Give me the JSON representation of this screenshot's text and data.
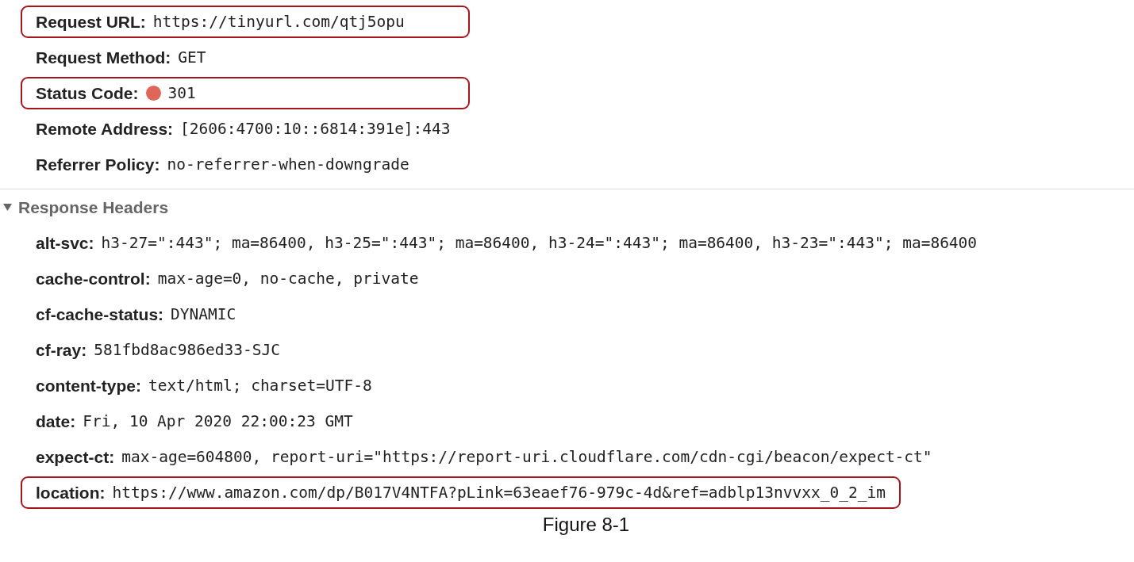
{
  "general": [
    {
      "name": "Request URL:",
      "value": "https://tinyurl.com/qtj5opu",
      "highlighted": true,
      "kind": "text"
    },
    {
      "name": "Request Method:",
      "value": "GET",
      "highlighted": false,
      "kind": "text"
    },
    {
      "name": "Status Code:",
      "value": "301",
      "highlighted": true,
      "kind": "status"
    },
    {
      "name": "Remote Address:",
      "value": "[2606:4700:10::6814:391e]:443",
      "highlighted": false,
      "kind": "text"
    },
    {
      "name": "Referrer Policy:",
      "value": "no-referrer-when-downgrade",
      "highlighted": false,
      "kind": "text"
    }
  ],
  "response_headers": {
    "title": "Response Headers",
    "expanded": true,
    "rows": [
      {
        "name": "alt-svc:",
        "value": "h3-27=\":443\"; ma=86400, h3-25=\":443\"; ma=86400, h3-24=\":443\"; ma=86400, h3-23=\":443\"; ma=86400",
        "highlighted": false
      },
      {
        "name": "cache-control:",
        "value": "max-age=0, no-cache, private",
        "highlighted": false
      },
      {
        "name": "cf-cache-status:",
        "value": "DYNAMIC",
        "highlighted": false
      },
      {
        "name": "cf-ray:",
        "value": "581fbd8ac986ed33-SJC",
        "highlighted": false
      },
      {
        "name": "content-type:",
        "value": "text/html; charset=UTF-8",
        "highlighted": false
      },
      {
        "name": "date:",
        "value": "Fri, 10 Apr 2020 22:00:23 GMT",
        "highlighted": false
      },
      {
        "name": "expect-ct:",
        "value": "max-age=604800, report-uri=\"https://report-uri.cloudflare.com/cdn-cgi/beacon/expect-ct\"",
        "highlighted": false
      },
      {
        "name": "location:",
        "value": "https://www.amazon.com/dp/B017V4NTFA?pLink=63eaef76-979c-4d&ref=adblp13nvvxx_0_2_im",
        "highlighted": true
      }
    ]
  },
  "caption": "Figure 8-1"
}
